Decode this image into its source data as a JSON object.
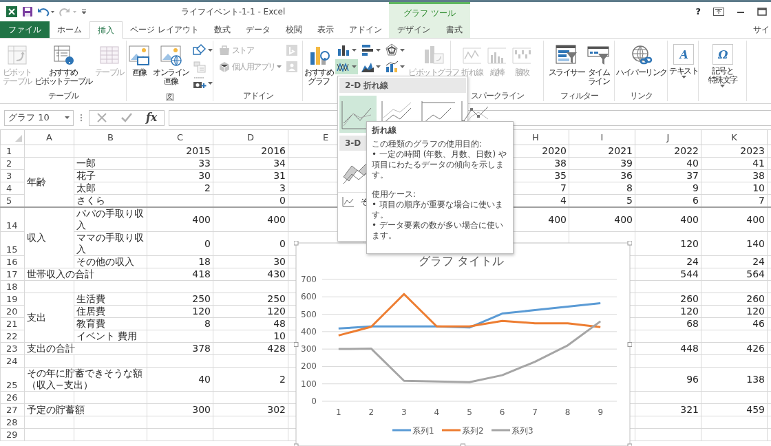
{
  "window": {
    "title": "ライフイベント-1-1 - Excel",
    "context_title": "グラフ ツール",
    "help": "?"
  },
  "tabs": [
    {
      "label": "ファイル",
      "kind": "file",
      "selected": false
    },
    {
      "label": "ホーム",
      "kind": "tab",
      "selected": false
    },
    {
      "label": "挿入",
      "kind": "tab",
      "selected": true
    },
    {
      "label": "ページ レイアウト",
      "kind": "tab",
      "selected": false
    },
    {
      "label": "数式",
      "kind": "tab",
      "selected": false
    },
    {
      "label": "データ",
      "kind": "tab",
      "selected": false
    },
    {
      "label": "校閲",
      "kind": "tab",
      "selected": false
    },
    {
      "label": "表示",
      "kind": "tab",
      "selected": false
    },
    {
      "label": "アドイン",
      "kind": "tab",
      "selected": false
    },
    {
      "label": "デザイン",
      "kind": "context",
      "selected": false
    },
    {
      "label": "書式",
      "kind": "context",
      "selected": false
    },
    {
      "label": "サイ",
      "kind": "account",
      "selected": false
    }
  ],
  "ribbon": [
    {
      "label": "テーブル",
      "items": [
        {
          "kind": "large",
          "label": "ピボットテーブル",
          "disabled": true,
          "dropdown": false
        },
        {
          "kind": "large",
          "label": "おすすめピボットテーブル",
          "disabled": false,
          "dropdown": false
        },
        {
          "kind": "large",
          "label": "テーブル",
          "disabled": true,
          "dropdown": false
        }
      ]
    },
    {
      "label": "図",
      "items": [
        {
          "kind": "large",
          "label": "画像",
          "disabled": false,
          "dropdown": false
        },
        {
          "kind": "large",
          "label": "オンライン画像",
          "disabled": false,
          "dropdown": false
        },
        {
          "kind": "stack",
          "items": [
            {
              "kind": "small",
              "disabled": false,
              "dropdown": true
            },
            {
              "kind": "small",
              "disabled": true,
              "dropdown": false
            },
            {
              "kind": "small",
              "disabled": false,
              "dropdown": true
            }
          ]
        }
      ]
    },
    {
      "label": "アドイン",
      "items": [
        {
          "kind": "stack",
          "items": [
            {
              "kind": "small",
              "label": "ストア",
              "disabled": true,
              "dropdown": false
            },
            {
              "kind": "small",
              "label": "個人用アプリ",
              "disabled": true,
              "dropdown": true
            }
          ]
        },
        {
          "kind": "stack",
          "items": [
            {
              "kind": "small",
              "disabled": true,
              "dropdown": false
            },
            {
              "kind": "small",
              "disabled": true,
              "dropdown": false
            }
          ]
        }
      ]
    },
    {
      "items": [
        {
          "kind": "large",
          "label": "おすすめグラフ",
          "disabled": false,
          "dropdown": false
        },
        {
          "kind": "stack",
          "items": [
            {
              "kind": "small",
              "disabled": false,
              "dropdown": true,
              "pressed": false
            },
            {
              "kind": "small",
              "disabled": false,
              "dropdown": true,
              "pressed": true
            }
          ]
        },
        {
          "kind": "stack",
          "items": [
            {
              "kind": "small",
              "disabled": false,
              "dropdown": true,
              "pressed": false
            },
            {
              "kind": "small",
              "disabled": false,
              "dropdown": true,
              "pressed": false
            }
          ]
        },
        {
          "kind": "stack",
          "items": [
            {
              "kind": "small",
              "disabled": false,
              "dropdown": true,
              "pressed": false
            },
            {
              "kind": "small",
              "disabled": false,
              "dropdown": true,
              "pressed": false
            }
          ]
        },
        {
          "kind": "large",
          "label": "ピボットグラフ",
          "disabled": true,
          "dropdown": false
        }
      ]
    },
    {
      "label": "スパークライン",
      "items": [
        {
          "kind": "large",
          "label": "折れ線",
          "disabled": true,
          "dropdown": false
        },
        {
          "kind": "large",
          "label": "縦棒",
          "disabled": true,
          "dropdown": false
        },
        {
          "kind": "large",
          "label": "勝敗",
          "disabled": true,
          "dropdown": false
        }
      ]
    },
    {
      "label": "フィルター",
      "items": [
        {
          "kind": "large",
          "label": "スライサー",
          "disabled": false,
          "dropdown": false
        },
        {
          "kind": "large",
          "label": "タイムライン",
          "disabled": false,
          "dropdown": false
        }
      ]
    },
    {
      "label": "リンク",
      "items": [
        {
          "kind": "large",
          "label": "ハイパーリンク",
          "disabled": false,
          "dropdown": false
        }
      ]
    },
    {
      "items": [
        {
          "kind": "large",
          "label": "テキスト",
          "glyph": "A",
          "disabled": false,
          "dropdown": true
        }
      ]
    },
    {
      "items": [
        {
          "kind": "large",
          "label": "記号と特殊文字",
          "glyph": "Ω",
          "disabled": false,
          "dropdown": true
        }
      ]
    }
  ],
  "formula_bar": {
    "name_box": "グラフ 10",
    "function_label": "fx"
  },
  "sheet": {
    "column_headers": {
      "A": "A",
      "B": "B",
      "C": "C",
      "D": "D",
      "E": "E",
      "H": "H",
      "I": "I",
      "J": "J",
      "K": "K"
    },
    "rows": [
      {
        "kind": "row",
        "number": "1",
        "values": {
          "C": "2015",
          "D": "2016",
          "H": "2020",
          "I": "2021",
          "J": "2022",
          "K": "2023"
        }
      },
      {
        "kind": "group",
        "label": "年齢",
        "rows": [
          {
            "kind": "row",
            "number": "2",
            "item": "一郎",
            "values": {
              "C": "33",
              "D": "34",
              "H": "38",
              "I": "39",
              "J": "40",
              "K": "41"
            }
          },
          {
            "kind": "row",
            "number": "3",
            "item": "花子",
            "values": {
              "C": "30",
              "D": "31",
              "H": "35",
              "I": "36",
              "J": "37",
              "K": "38"
            }
          },
          {
            "kind": "row",
            "number": "4",
            "item": "太郎",
            "values": {
              "C": "2",
              "D": "3",
              "H": "7",
              "I": "8",
              "J": "9",
              "K": "10"
            }
          },
          {
            "kind": "row",
            "number": "5",
            "item": "さくら",
            "values": {
              "D": "0",
              "H": "4",
              "I": "5",
              "J": "6",
              "K": "7"
            }
          }
        ]
      },
      {
        "kind": "group",
        "label": "収入",
        "rows": [
          {
            "kind": "row",
            "number": "14",
            "item": "パパの手取り収入",
            "values": {
              "C": "400",
              "D": "400",
              "H": "400",
              "I": "400",
              "J": "400",
              "K": "400"
            }
          },
          {
            "kind": "row",
            "number": "15",
            "item": "ママの手取り収入",
            "values": {
              "C": "0",
              "D": "0",
              "J": "120",
              "K": "140"
            }
          },
          {
            "kind": "row",
            "number": "16",
            "item": "その他の収入",
            "values": {
              "C": "18",
              "D": "30",
              "J": "24",
              "K": "24"
            }
          }
        ]
      },
      {
        "kind": "merged",
        "number": "17",
        "title": "世帯収入の合計",
        "values": {
          "C": "418",
          "D": "430",
          "J": "544",
          "K": "564"
        }
      },
      {
        "kind": "row",
        "number": "18"
      },
      {
        "kind": "group",
        "label": "支出",
        "rows": [
          {
            "kind": "row",
            "number": "19",
            "item": "生活費",
            "values": {
              "C": "250",
              "D": "250",
              "J": "260",
              "K": "260"
            }
          },
          {
            "kind": "row",
            "number": "20",
            "item": "住居費",
            "values": {
              "C": "120",
              "D": "120",
              "J": "120",
              "K": "120"
            }
          },
          {
            "kind": "row",
            "number": "21",
            "item": "教育費",
            "values": {
              "C": "8",
              "D": "48",
              "J": "68",
              "K": "46"
            }
          },
          {
            "kind": "row",
            "number": "22",
            "item": "イベント 費用",
            "values": {
              "D": "10"
            }
          }
        ]
      },
      {
        "kind": "merged",
        "number": "23",
        "title": "支出の合計",
        "values": {
          "C": "378",
          "D": "428",
          "J": "448",
          "K": "426"
        }
      },
      {
        "kind": "row",
        "number": "24"
      },
      {
        "kind": "merged",
        "number": "25",
        "title": "その年に貯蓄できそうな額（収入−支出）",
        "values": {
          "C": "40",
          "D": "2",
          "J": "96",
          "K": "138"
        }
      },
      {
        "kind": "row",
        "number": "26"
      },
      {
        "kind": "merged",
        "number": "27",
        "title": "予定の貯蓄額",
        "values": {
          "C": "300",
          "D": "302",
          "J": "321",
          "K": "459"
        }
      },
      {
        "kind": "row",
        "number": "28"
      },
      {
        "kind": "row",
        "number": "29"
      }
    ]
  },
  "chart": {
    "chart_data": {
      "type": "line",
      "title": "グラフ タイトル",
      "categories": [
        "1",
        "2",
        "3",
        "4",
        "5",
        "6",
        "7",
        "8",
        "9"
      ],
      "ylim": [
        0,
        700
      ],
      "yticks": [
        0,
        100,
        200,
        300,
        400,
        500,
        600,
        700
      ],
      "grid": true,
      "legend": "bottom",
      "series": [
        {
          "name": "系列1",
          "color": "#5b9bd5",
          "values": [
            418,
            430,
            430,
            430,
            424,
            504,
            524,
            544,
            564
          ]
        },
        {
          "name": "系列2",
          "color": "#ed7d31",
          "values": [
            378,
            428,
            616,
            430,
            430,
            462,
            448,
            448,
            426
          ]
        },
        {
          "name": "系列3",
          "color": "#a5a5a5",
          "values": [
            300,
            302,
            118,
            114,
            110,
            150,
            227,
            321,
            459
          ]
        }
      ]
    }
  },
  "chart_menu": {
    "sections": [
      {
        "heading": "2-D 折れ線",
        "items": [
          {
            "selected": true
          },
          {
            "selected": false
          },
          {
            "selected": false
          },
          {
            "selected": false
          }
        ]
      },
      {
        "heading": "3-D",
        "items": [
          {
            "selected": false
          }
        ]
      }
    ],
    "footer": "そ"
  },
  "tooltip": {
    "title": "折れ線",
    "blocks": [
      [
        "この種類のグラフの使用目的:",
        "• 一定の時間 (年数、月数、日数) や項目にわたるデータの傾向を示します。"
      ],
      [
        "使用ケース:",
        "• 項目の順序が重要な場合に使います。",
        "• データ要素の数が多い場合に使います。"
      ]
    ]
  }
}
